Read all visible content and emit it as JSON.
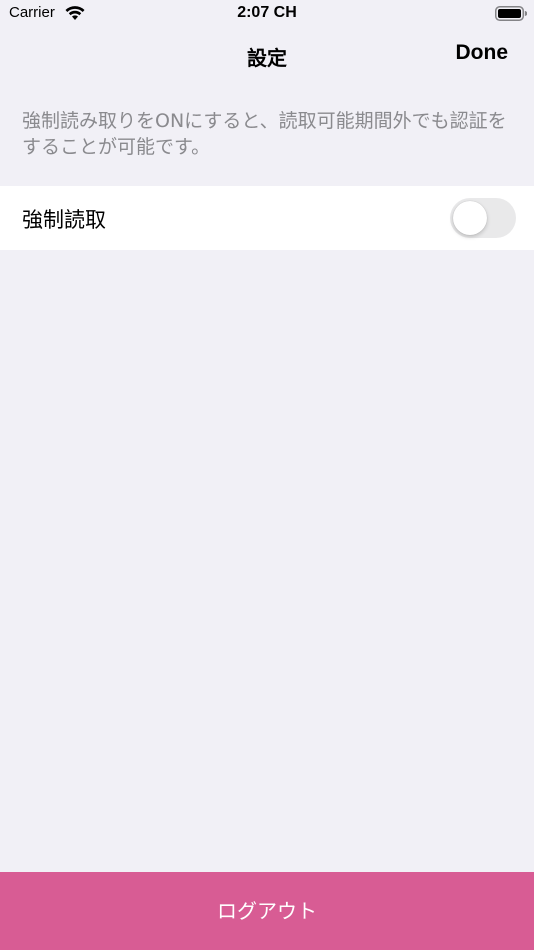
{
  "status_bar": {
    "carrier": "Carrier",
    "time": "2:07 CH",
    "wifi_icon": "wifi-icon",
    "battery_icon": "battery-icon"
  },
  "nav": {
    "title": "設定",
    "done_label": "Done"
  },
  "settings": {
    "description": "強制読み取りをONにすると、読取可能期間外でも認証をすることが可能です。",
    "force_read_label": "強制読取",
    "force_read_enabled": false
  },
  "footer": {
    "logout_label": "ログアウト"
  },
  "colors": {
    "background": "#f1f0f6",
    "logout_button": "#d85c94",
    "toggle_off": "#e9e9ea",
    "secondary_text": "#8a8a8e"
  }
}
